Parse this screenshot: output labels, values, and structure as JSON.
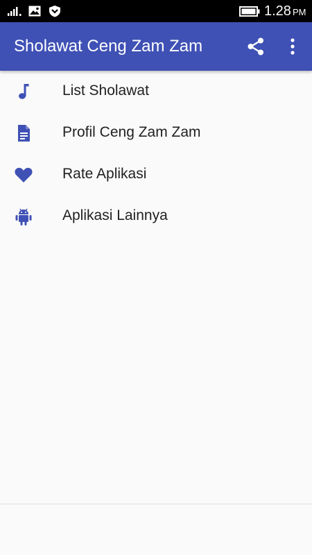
{
  "status_bar": {
    "time": "1.28",
    "ampm": "PM",
    "icons": [
      "signal-icon",
      "gallery-icon",
      "shield-icon",
      "battery-icon"
    ]
  },
  "app_bar": {
    "title": "Sholawat Ceng Zam Zam",
    "actions": [
      "share-icon",
      "more-vert-icon"
    ]
  },
  "menu": {
    "items": [
      {
        "label": "List Sholawat",
        "icon": "music-note-icon"
      },
      {
        "label": "Profil Ceng Zam Zam",
        "icon": "document-icon"
      },
      {
        "label": "Rate Aplikasi",
        "icon": "heart-icon"
      },
      {
        "label": "Aplikasi Lainnya",
        "icon": "android-icon"
      }
    ]
  },
  "colors": {
    "primary": "#3f51b5",
    "background": "#fafafa",
    "status_bar": "#000000"
  }
}
